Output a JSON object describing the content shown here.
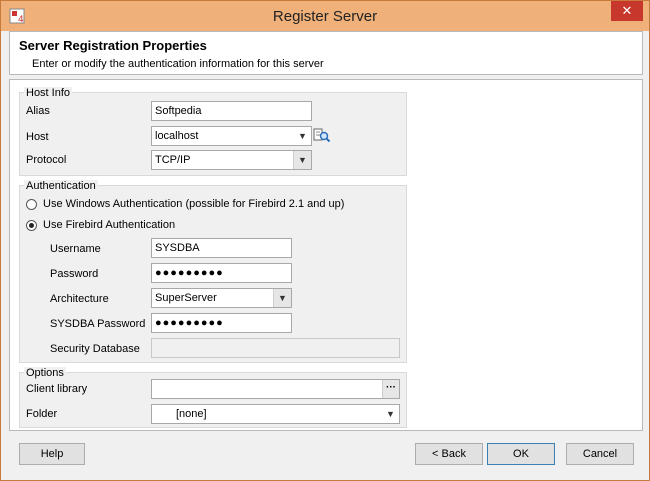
{
  "window": {
    "title": "Register Server",
    "close_glyph": "✕",
    "accent_color": "#f0b07a"
  },
  "header": {
    "title": "Server Registration Properties",
    "subtitle": "Enter or modify the authentication information for this server"
  },
  "host_info": {
    "group_label": "Host Info",
    "alias_label": "Alias",
    "alias_value": "Softpedia",
    "host_label": "Host",
    "host_value": "localhost",
    "protocol_label": "Protocol",
    "protocol_value": "TCP/IP"
  },
  "authentication": {
    "group_label": "Authentication",
    "windows_auth_label": "Use Windows Authentication (possible for Firebird 2.1 and up)",
    "firebird_auth_label": "Use Firebird Authentication",
    "selected": "firebird",
    "username_label": "Username",
    "username_value": "SYSDBA",
    "password_label": "Password",
    "password_value": "●●●●●●●●●",
    "architecture_label": "Architecture",
    "architecture_value": "SuperServer",
    "sysdba_password_label": "SYSDBA Password",
    "sysdba_password_value": "●●●●●●●●●",
    "security_db_label": "Security Database",
    "security_db_value": ""
  },
  "options": {
    "group_label": "Options",
    "client_library_label": "Client library",
    "client_library_value": "",
    "browse_glyph": "···",
    "folder_label": "Folder",
    "folder_value": "[none]"
  },
  "buttons": {
    "help": "Help",
    "back": "< Back",
    "ok": "OK",
    "cancel": "Cancel"
  },
  "icons": {
    "app": "firebird-app-icon",
    "host_browse": "search-server-icon",
    "dropdown": "chevron-down-icon"
  }
}
